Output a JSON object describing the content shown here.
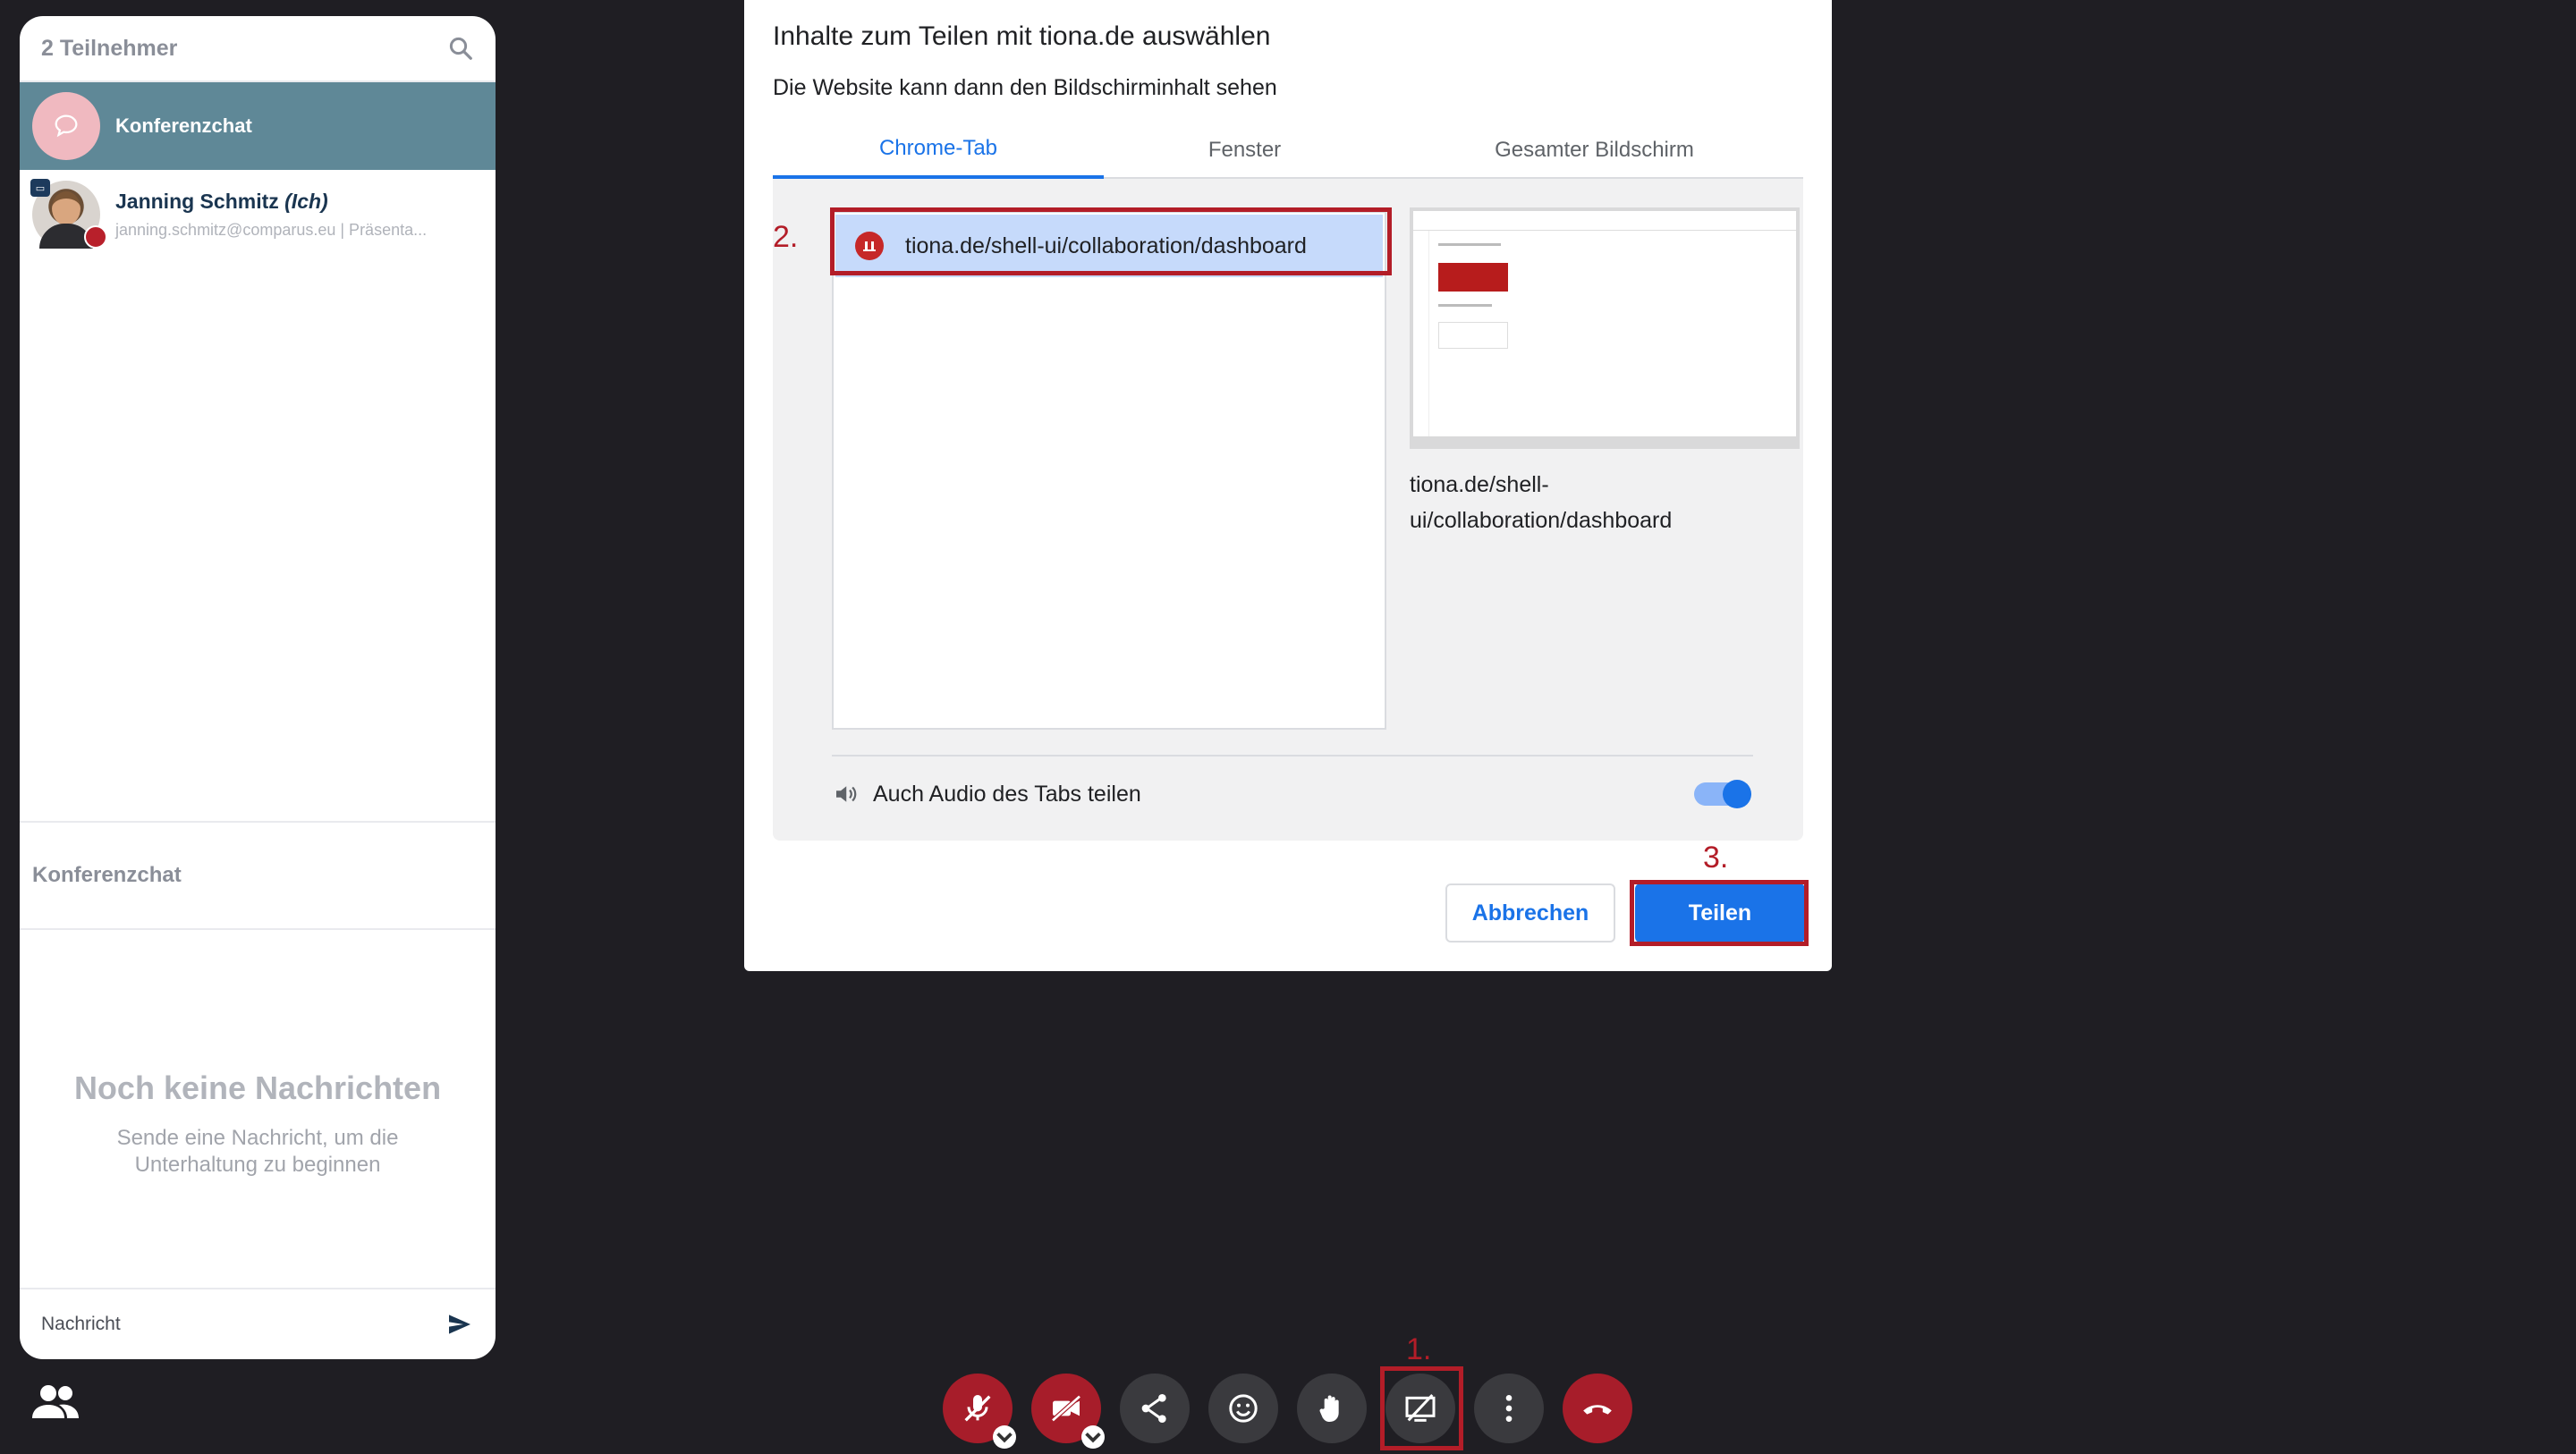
{
  "panel": {
    "title": "2 Teilnehmer",
    "conference_chat_label": "Konferenzchat",
    "user": {
      "name": "Janning Schmitz",
      "me_suffix": "(Ich)",
      "subtitle": "janning.schmitz@comparus.eu | Präsenta..."
    },
    "chat_header": "Konferenzchat",
    "empty_title": "Noch keine Nachrichten",
    "empty_subtitle": "Sende eine Nachricht, um die Unterhaltung zu beginnen",
    "message_placeholder": "Nachricht"
  },
  "dialog": {
    "title": "Inhalte zum Teilen mit tiona.de auswählen",
    "subtitle": "Die Website kann dann den Bildschirminhalt sehen",
    "tabs": [
      "Chrome-Tab",
      "Fenster",
      "Gesamter Bildschirm"
    ],
    "active_tab": "Chrome-Tab",
    "tab_item_url": "tiona.de/shell-ui/collaboration/dashboard",
    "preview_caption": "tiona.de/shell-ui/collaboration/dashboard",
    "audio_label": "Auch Audio des Tabs teilen",
    "audio_enabled": true,
    "cancel_label": "Abbrechen",
    "share_label": "Teilen"
  },
  "annotations": {
    "step1": "1.",
    "step2": "2.",
    "step3": "3."
  },
  "toolbar": {
    "buttons": [
      "microphone-muted",
      "camera-off",
      "share",
      "emoji",
      "raise-hand",
      "screen-share-off",
      "more",
      "hang-up"
    ]
  },
  "colors": {
    "accent": "#1a73e8",
    "danger": "#a71d2a",
    "annotation": "#b31d28",
    "selected_row": "#5f8897"
  }
}
